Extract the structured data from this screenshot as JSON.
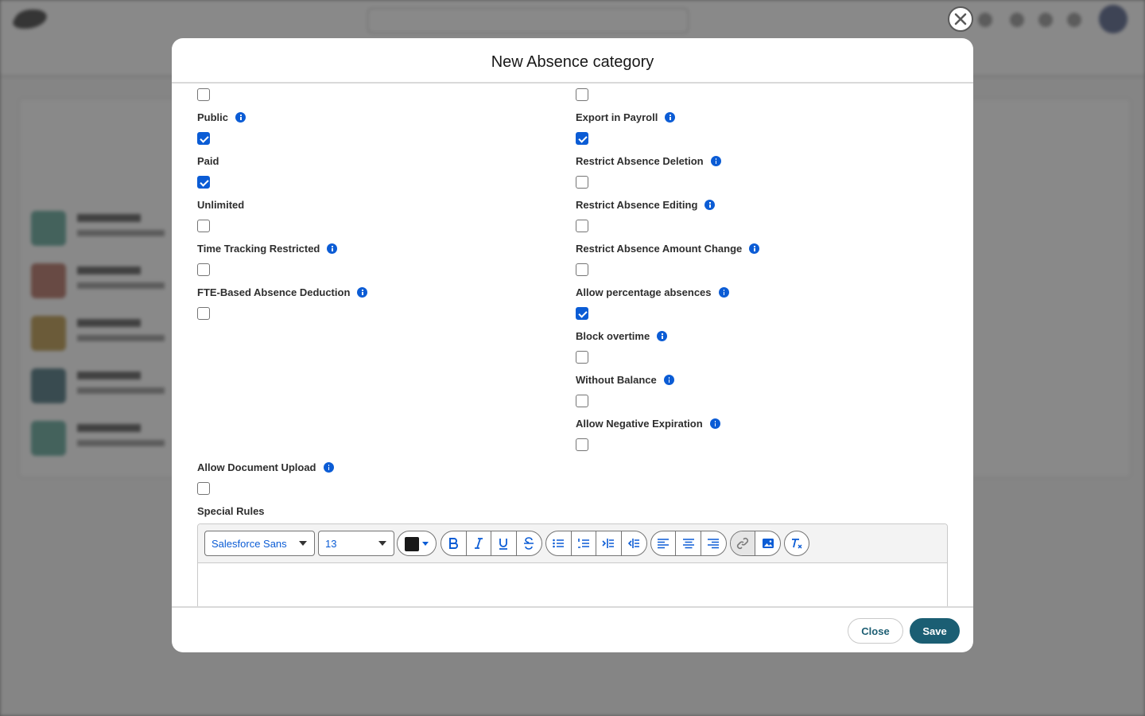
{
  "modal": {
    "title": "New Absence category",
    "close_label": "Close",
    "save_label": "Save"
  },
  "fields_left": [
    {
      "label": "Public",
      "checked": true,
      "info": true
    },
    {
      "label": "Paid",
      "checked": true,
      "info": false
    },
    {
      "label": "Unlimited",
      "checked": false,
      "info": false
    },
    {
      "label": "Time Tracking Restricted",
      "checked": false,
      "info": true
    },
    {
      "label": "FTE-Based Absence Deduction",
      "checked": false,
      "info": true
    }
  ],
  "fields_right": [
    {
      "label": "Export in Payroll",
      "checked": true,
      "info": true
    },
    {
      "label": "Restrict Absence Deletion",
      "checked": false,
      "info": true
    },
    {
      "label": "Restrict Absence Editing",
      "checked": false,
      "info": true
    },
    {
      "label": "Restrict Absence Amount Change",
      "checked": false,
      "info": true
    },
    {
      "label": "Allow percentage absences",
      "checked": true,
      "info": true
    },
    {
      "label": "Block overtime",
      "checked": false,
      "info": true
    },
    {
      "label": "Without Balance",
      "checked": false,
      "info": true
    },
    {
      "label": "Allow Negative Expiration",
      "checked": false,
      "info": true
    }
  ],
  "document_upload": {
    "label": "Allow Document Upload",
    "checked": false,
    "info": true
  },
  "special_rules": {
    "label": "Special Rules",
    "font_family_value": "Salesforce Sans",
    "font_size_value": "13",
    "text_color": "#181818"
  },
  "colors": {
    "accent": "#0b5cd5",
    "primary_button": "#1b5e73"
  }
}
